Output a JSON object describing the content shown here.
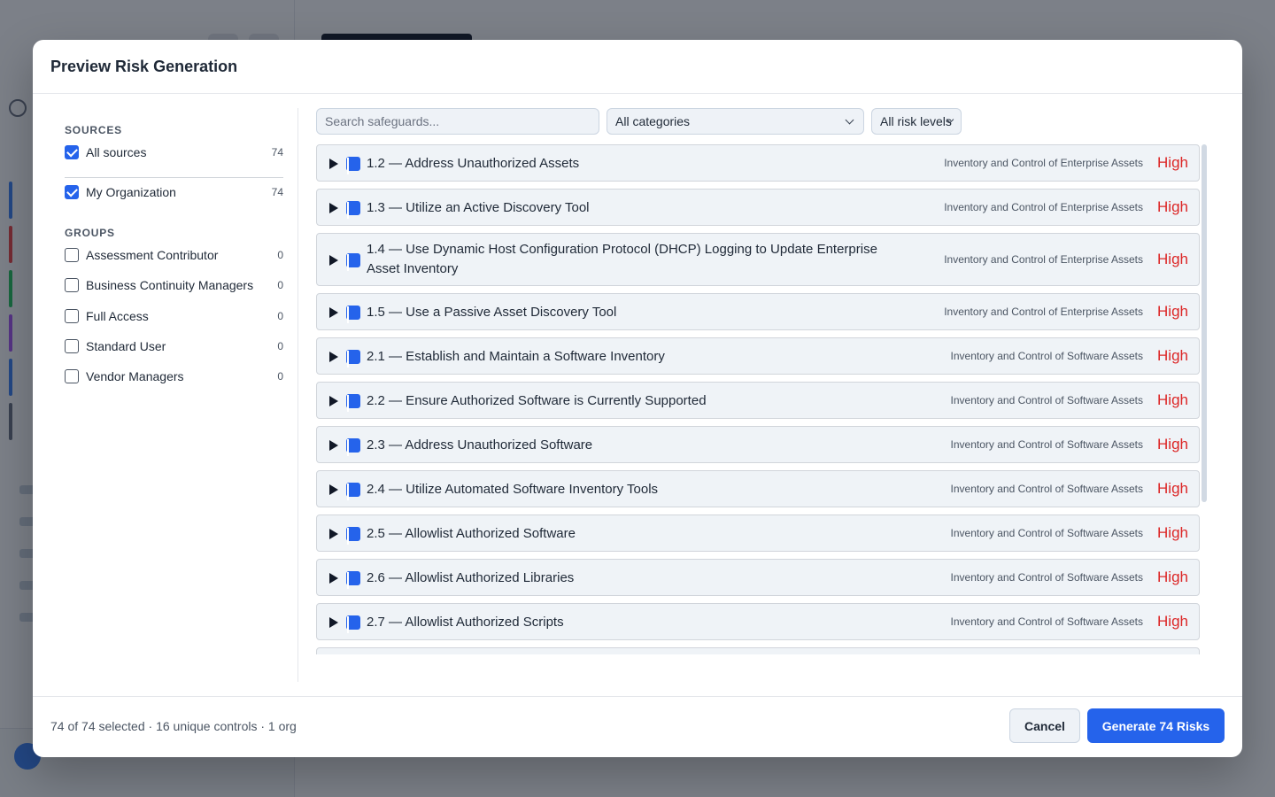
{
  "modal": {
    "title": "Preview Risk Generation"
  },
  "sources": {
    "heading": "SOURCES",
    "all": {
      "label": "All sources",
      "count": "74",
      "checked": true
    },
    "items": [
      {
        "label": "My Organization",
        "count": "74",
        "checked": true
      }
    ]
  },
  "groups": {
    "heading": "GROUPS",
    "items": [
      {
        "label": "Assessment Contributor",
        "count": "0",
        "checked": false
      },
      {
        "label": "Business Continuity Managers",
        "count": "0",
        "checked": false
      },
      {
        "label": "Full Access",
        "count": "0",
        "checked": false
      },
      {
        "label": "Standard User",
        "count": "0",
        "checked": false
      },
      {
        "label": "Vendor Managers",
        "count": "0",
        "checked": false
      }
    ]
  },
  "filters": {
    "search_placeholder": "Search safeguards...",
    "category_selected": "All categories",
    "risk_selected": "All risk levels"
  },
  "safeguards": [
    {
      "title": "1.2 — Address Unauthorized Assets",
      "category": "Inventory and Control of Enterprise Assets",
      "risk": "High"
    },
    {
      "title": "1.3 — Utilize an Active Discovery Tool",
      "category": "Inventory and Control of Enterprise Assets",
      "risk": "High"
    },
    {
      "title": "1.4 — Use Dynamic Host Configuration Protocol (DHCP) Logging to Update Enterprise Asset Inventory",
      "category": "Inventory and Control of Enterprise Assets",
      "risk": "High"
    },
    {
      "title": "1.5 — Use a Passive Asset Discovery Tool",
      "category": "Inventory and Control of Enterprise Assets",
      "risk": "High"
    },
    {
      "title": "2.1 — Establish and Maintain a Software Inventory",
      "category": "Inventory and Control of Software Assets",
      "risk": "High"
    },
    {
      "title": "2.2 — Ensure Authorized Software is Currently Supported",
      "category": "Inventory and Control of Software Assets",
      "risk": "High"
    },
    {
      "title": "2.3 — Address Unauthorized Software",
      "category": "Inventory and Control of Software Assets",
      "risk": "High"
    },
    {
      "title": "2.4 — Utilize Automated Software Inventory Tools",
      "category": "Inventory and Control of Software Assets",
      "risk": "High"
    },
    {
      "title": "2.5 — Allowlist Authorized Software",
      "category": "Inventory and Control of Software Assets",
      "risk": "High"
    },
    {
      "title": "2.6 — Allowlist Authorized Libraries",
      "category": "Inventory and Control of Software Assets",
      "risk": "High"
    },
    {
      "title": "2.7 — Allowlist Authorized Scripts",
      "category": "Inventory and Control of Software Assets",
      "risk": "High"
    }
  ],
  "footer": {
    "summary": "74 of 74 selected · 16 unique controls · 1 org",
    "cancel_label": "Cancel",
    "generate_label": "Generate 74 Risks"
  },
  "colors": {
    "accent": "#2563eb",
    "risk_high": "#dc2626"
  }
}
